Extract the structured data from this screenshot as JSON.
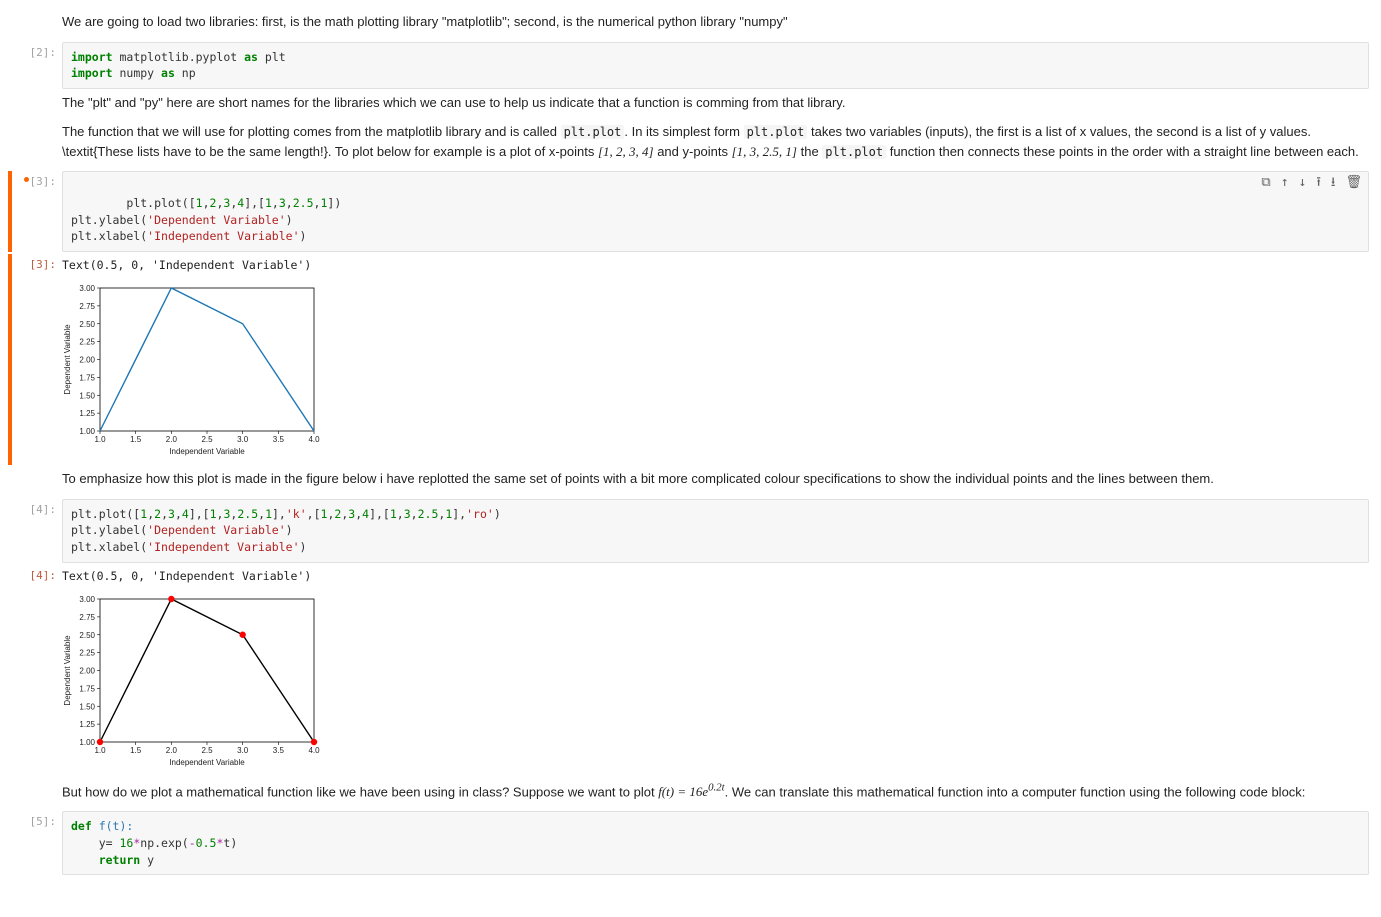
{
  "md": {
    "intro": "We are going to load two libraries: first, is the math plotting library \"matplotlib\"; second, is the numerical python library \"numpy\"",
    "pltnp": "The \"plt\" and \"py\" here are short names for the libraries which we can use to help us indicate that a function is comming from that library.",
    "plotfn_a": "The function that we will use for plotting comes from the matplotlib library and is called ",
    "plotfn_b": ". In its simplest form ",
    "plotfn_c": " takes two variables (inputs), the first is a list of x values, the second is a list of y values. \\textit{These lists have to be the same length!}. To plot below for example is a plot of x-points ",
    "plotfn_d": " and y-points ",
    "plotfn_e": " the ",
    "plotfn_f": " function then connects these points in the order with a straight line between each.",
    "xpts": "[1, 2, 3, 4]",
    "ypts": "[1, 3, 2.5, 1]",
    "pltplot": "plt.plot",
    "emph": "To emphasize how this plot is made in the figure below i have replotted the same set of points with a bit more complicated colour specifications to show the individual points and the lines between them.",
    "howplot_a": "But how do we plot a mathematical function like we have been using in class? Suppose we want to plot ",
    "howplot_b": ". We can translate this mathematical function into a computer function using the following code block:",
    "ft": "f(t) = 16e",
    "ft_exp": "0.2t"
  },
  "prompts": {
    "p2": "[2]:",
    "p3": "[3]:",
    "p4": "[4]:",
    "p5": "[5]:",
    "dot3": "•"
  },
  "code": {
    "c2_l1_k1": "import",
    "c2_l1_n": " matplotlib.pyplot ",
    "c2_l1_k2": "as",
    "c2_l1_a": " plt",
    "c2_l2_k1": "import",
    "c2_l2_n": " numpy ",
    "c2_l2_k2": "as",
    "c2_l2_a": " np",
    "c3_l1_a": "plt.plot(",
    "c3_l1_b": "[",
    "c3_l1_n1": "1",
    "c3_l1_c": ",",
    "c3_l1_n2": "2",
    "c3_l1_d": ",",
    "c3_l1_n3": "3",
    "c3_l1_e": ",",
    "c3_l1_n4": "4",
    "c3_l1_f": "],[",
    "c3_l1_n5": "1",
    "c3_l1_g": ",",
    "c3_l1_n6": "3",
    "c3_l1_h": ",",
    "c3_l1_n7": "2.5",
    "c3_l1_i": ",",
    "c3_l1_n8": "1",
    "c3_l1_j": "])",
    "c3_l2_a": "plt.ylabel(",
    "c3_l2_s": "'Dependent Variable'",
    "c3_l2_b": ")",
    "c3_l3_a": "plt.xlabel(",
    "c3_l3_s": "'Independent Variable'",
    "c3_l3_b": ")",
    "c4_l1": "plt.plot([1,2,3,4],[1,3,2.5,1],'k',[1,2,3,4],[1,3,2.5,1],'ro')",
    "c4_l2_a": "plt.ylabel(",
    "c4_l2_s": "'Dependent Variable'",
    "c4_l2_b": ")",
    "c4_l3_a": "plt.xlabel(",
    "c4_l3_s": "'Independent Variable'",
    "c4_l3_b": ")",
    "c5_l1_k": "def ",
    "c5_l1_a": "f(t):",
    "c5_l2_a": "    y= ",
    "c5_l2_n1": "16",
    "c5_l2_b": "*np.exp(-",
    "c5_l2_n2": "0.5",
    "c5_l2_c": "*t)",
    "c5_l3_k": "    return ",
    "c5_l3_a": "y"
  },
  "out": {
    "o3": "Text(0.5, 0, 'Independent Variable')",
    "o4": "Text(0.5, 0, 'Independent Variable')"
  },
  "toolbar": {
    "dup": "⧉",
    "up": "↑",
    "down": "↓",
    "insert_above": "⭱",
    "insert_below": "⭳",
    "del": "🗑"
  },
  "chart_data": [
    {
      "type": "line",
      "title": "",
      "xlabel": "Independent Variable",
      "ylabel": "Dependent Variable",
      "x": [
        1,
        2,
        3,
        4
      ],
      "y": [
        1,
        3,
        2.5,
        1
      ],
      "xticks": [
        1.0,
        1.5,
        2.0,
        2.5,
        3.0,
        3.5,
        4.0
      ],
      "yticks": [
        1.0,
        1.25,
        1.5,
        1.75,
        2.0,
        2.25,
        2.5,
        2.75,
        3.0
      ],
      "line_color": "#1f77b4"
    },
    {
      "type": "line+scatter",
      "title": "",
      "xlabel": "Independent Variable",
      "ylabel": "Dependent Variable",
      "x": [
        1,
        2,
        3,
        4
      ],
      "y": [
        1,
        3,
        2.5,
        1
      ],
      "xticks": [
        1.0,
        1.5,
        2.0,
        2.5,
        3.0,
        3.5,
        4.0
      ],
      "yticks": [
        1.0,
        1.25,
        1.5,
        1.75,
        2.0,
        2.25,
        2.5,
        2.75,
        3.0
      ],
      "line_color": "#000000",
      "marker_color": "#ff0000"
    }
  ]
}
